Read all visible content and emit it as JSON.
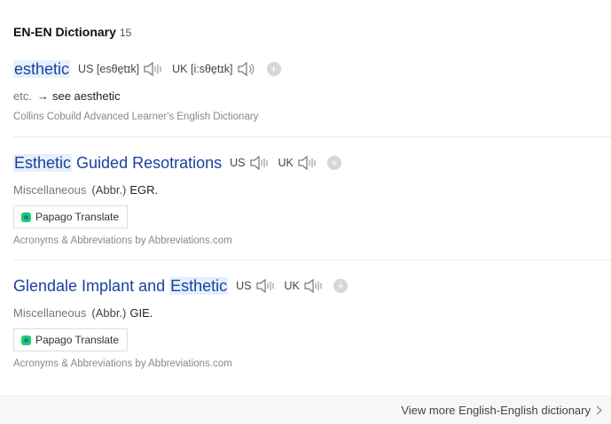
{
  "header": {
    "title": "EN-EN Dictionary",
    "count": "15"
  },
  "entries": [
    {
      "word_parts": [
        "esthetic",
        ""
      ],
      "pron": [
        {
          "label": "US",
          "ipa": "[esθe̱tɪk]"
        },
        {
          "label": "UK",
          "ipa": "[i:sθe̱tɪk]"
        }
      ],
      "def": {
        "pos": "etc.",
        "arrow": "→",
        "text": "see aesthetic"
      },
      "source": "Collins Cobuild Advanced Learner's English Dictionary"
    },
    {
      "word_hl": "Esthetic",
      "word_rest": " Guided Resotrations",
      "pron": [
        {
          "label": "US",
          "ipa": ""
        },
        {
          "label": "UK",
          "ipa": ""
        }
      ],
      "def": {
        "pos": "Miscellaneous",
        "tag": "(Abbr.)",
        "value": "EGR."
      },
      "translate_label": "Papago Translate",
      "source": "Acronyms & Abbreviations by Abbreviations.com"
    },
    {
      "word_pre": "Glendale Implant and ",
      "word_hl": "Esthetic",
      "pron": [
        {
          "label": "US",
          "ipa": ""
        },
        {
          "label": "UK",
          "ipa": ""
        }
      ],
      "def": {
        "pos": "Miscellaneous",
        "tag": "(Abbr.)",
        "value": "GIE."
      },
      "translate_label": "Papago Translate",
      "source": "Acronyms & Abbreviations by Abbreviations.com"
    }
  ],
  "footer": {
    "more_label": "View more English-English dictionary"
  },
  "colors": {
    "link": "#1a3fa0",
    "highlight": "#e5f1fb",
    "footer_bg": "#f7f7f7"
  },
  "icons": {
    "speaker": "speaker-icon",
    "add": "plus-circle-icon",
    "chevron": "chevron-right-icon",
    "papago": "papago-logo-icon"
  }
}
